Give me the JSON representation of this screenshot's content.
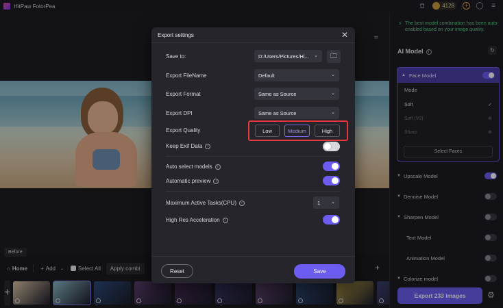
{
  "app": {
    "title": "HitPaw FotorPea",
    "credits": "4128"
  },
  "preview": {
    "before_label": "Before"
  },
  "bottombar": {
    "home_label": "Home",
    "add_label": "Add",
    "select_all_label": "Select All",
    "apply_label": "Apply combi"
  },
  "thumbnails": [
    "#d9c3a5",
    "#8ab7c4",
    "#2d4a7a",
    "#5b3d6e",
    "#4a2f5a",
    "#3f3a6b",
    "#6a4a7c",
    "#2f4f7f",
    "#b9a24a",
    "#3a3f6a"
  ],
  "right_panel": {
    "notice": "The best model combination has been auto-enabled based on your image quality.",
    "ai_model_title": "AI Model",
    "face_model": {
      "label": "Face Model",
      "mode_label": "Mode",
      "modes": [
        {
          "label": "Soft",
          "state": "active"
        },
        {
          "label": "Soft (V2)",
          "state": "download"
        },
        {
          "label": "Sharp",
          "state": "download"
        }
      ],
      "select_faces": "Select Faces"
    },
    "models": [
      {
        "label": "Upscale Model",
        "on": true,
        "chev": true
      },
      {
        "label": "Denoise Model",
        "on": false,
        "chev": true
      },
      {
        "label": "Sharpen Model",
        "on": false,
        "chev": true
      },
      {
        "label": "Text Model",
        "on": false,
        "chev": false
      },
      {
        "label": "Animation Model",
        "on": false,
        "chev": false
      },
      {
        "label": "Colorize model",
        "on": false,
        "chev": true
      }
    ],
    "export_button": "Export 233 images"
  },
  "dialog": {
    "title": "Export settings",
    "save_to_label": "Save to:",
    "save_to_value": "D:/Users/Pictures/Hi...",
    "filename_label": "Export FileName",
    "filename_value": "Default",
    "format_label": "Export Format",
    "format_value": "Same as Source",
    "dpi_label": "Export DPI",
    "dpi_value": "Same as Source",
    "quality_label": "Export Quality",
    "quality_options": [
      "Low",
      "Medium",
      "High"
    ],
    "quality_selected": "Medium",
    "exif_label": "Keep Exif Data",
    "exif_on": false,
    "auto_select_label": "Auto select models",
    "auto_select_on": true,
    "auto_preview_label": "Automatic preview",
    "auto_preview_on": true,
    "max_tasks_label": "Maximum Active Tasks(CPU)",
    "max_tasks_value": "1",
    "high_res_label": "High Res Acceleration",
    "high_res_on": true,
    "reset_label": "Reset",
    "save_label": "Save"
  }
}
